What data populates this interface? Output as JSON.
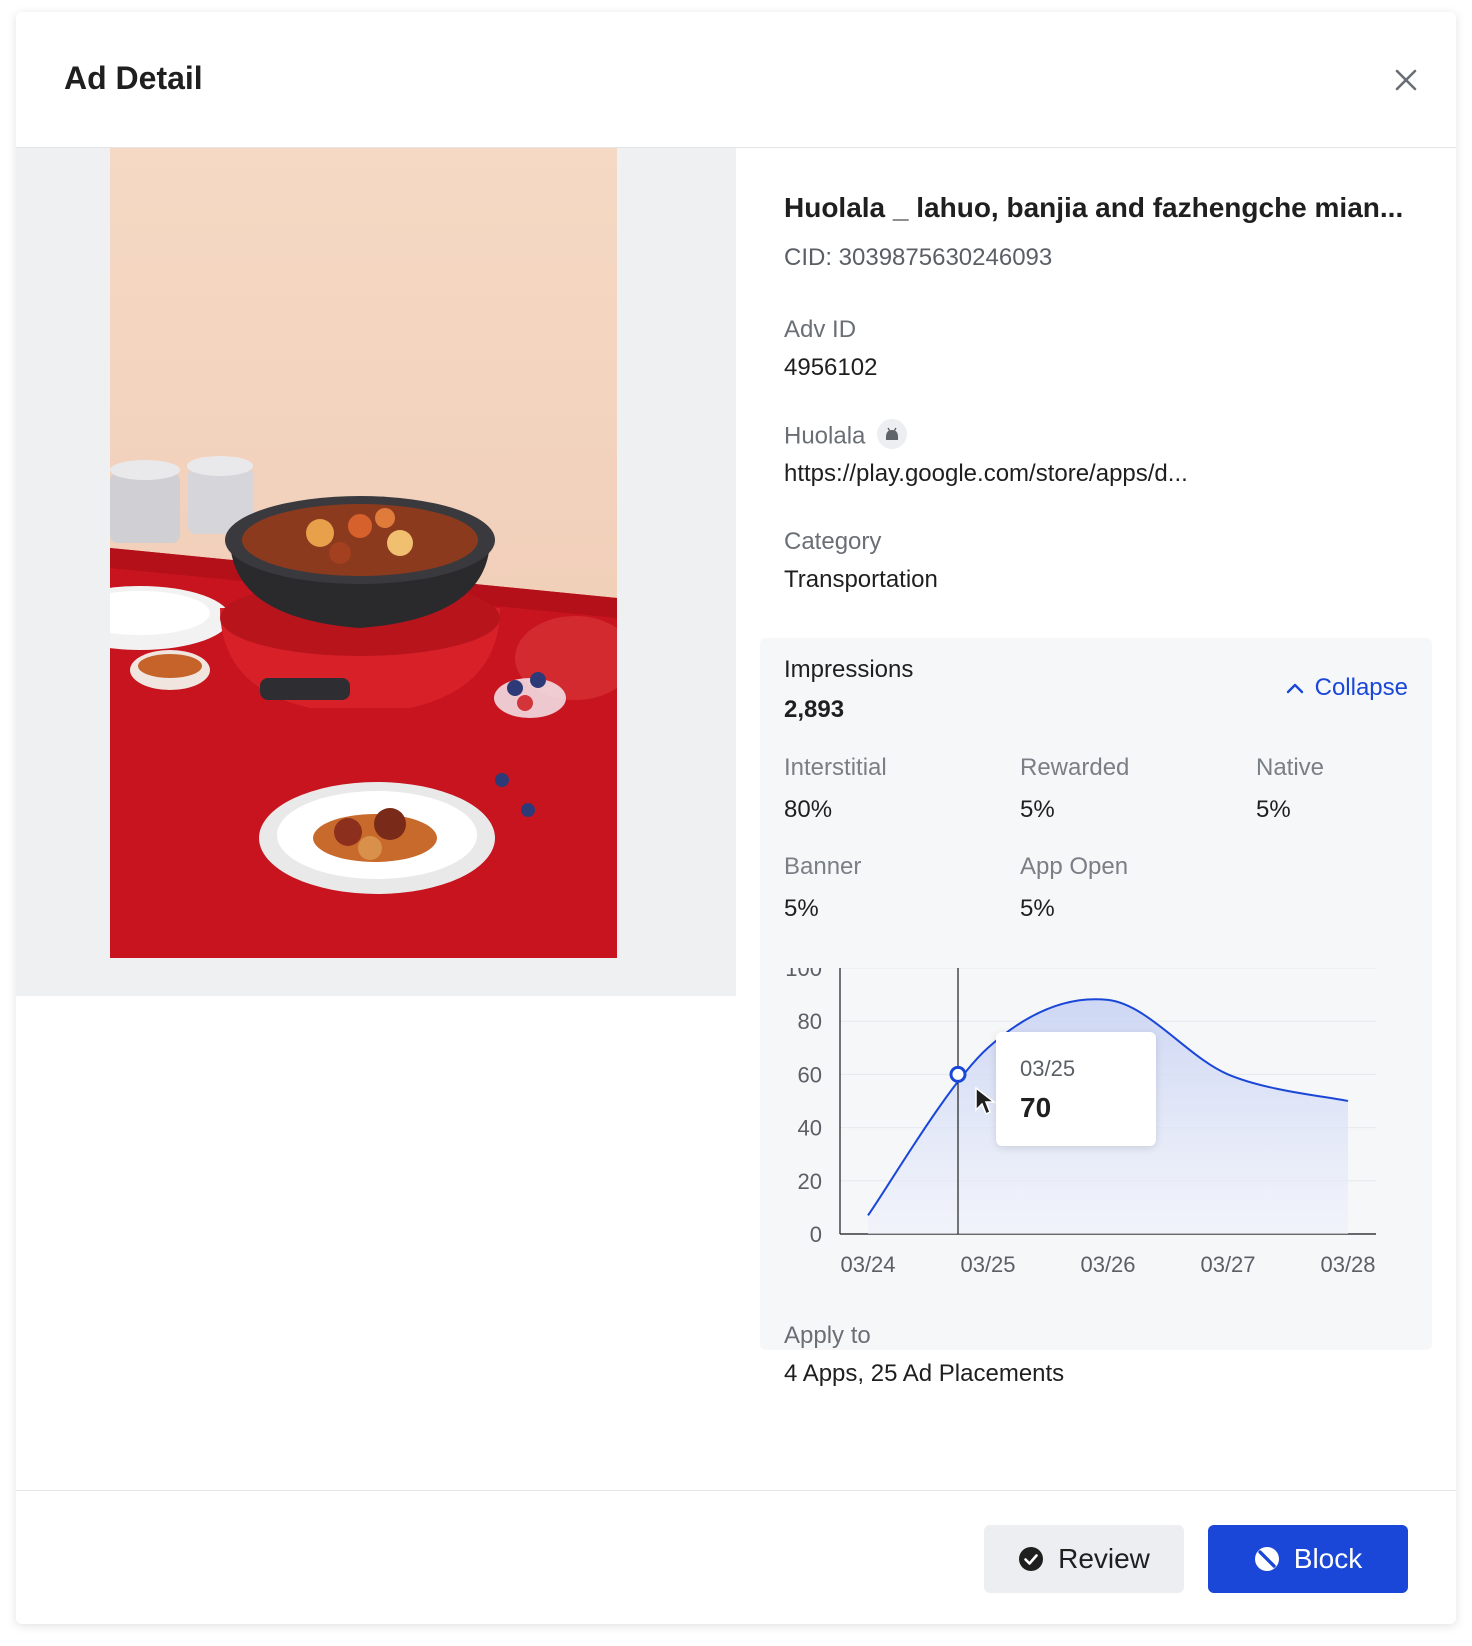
{
  "header": {
    "title": "Ad Detail"
  },
  "ad": {
    "title": "Huolala _ lahuo, banjia and fazhengche mian...",
    "cid": "CID: 3039875630246093",
    "adv_id_label": "Adv ID",
    "adv_id_value": "4956102",
    "app_name": "Huolala",
    "app_platform_icon": "android-icon",
    "app_url": "https://play.google.com/store/apps/d...",
    "category_label": "Category",
    "category_value": "Transportation"
  },
  "impressions": {
    "label": "Impressions",
    "value": "2,893",
    "collapse_label": "Collapse",
    "breakdown": [
      {
        "label": "Interstitial",
        "value": "80%"
      },
      {
        "label": "Rewarded",
        "value": "5%"
      },
      {
        "label": "Native",
        "value": "5%"
      },
      {
        "label": "Banner",
        "value": "5%"
      },
      {
        "label": "App Open",
        "value": "5%"
      }
    ],
    "tooltip": {
      "date": "03/25",
      "value": "70"
    }
  },
  "chart_data": {
    "type": "area",
    "x": [
      "03/24",
      "03/25",
      "03/26",
      "03/27",
      "03/28"
    ],
    "y_ticks": [
      "0",
      "20",
      "40",
      "60",
      "80",
      "100"
    ],
    "ylim": [
      0,
      100
    ],
    "series": [
      {
        "values": [
          7,
          70,
          88,
          60,
          50
        ]
      }
    ],
    "grid": true,
    "color": "#1a47d8",
    "fill_color": "#dbe2f7",
    "hover": {
      "x": "03/25",
      "y": 60
    }
  },
  "apply": {
    "label": "Apply to",
    "value": "4 Apps, 25 Ad Placements"
  },
  "footer": {
    "review_label": "Review",
    "block_label": "Block"
  },
  "colors": {
    "accent": "#1a47d8",
    "panel_bg": "#f6f7f9"
  }
}
